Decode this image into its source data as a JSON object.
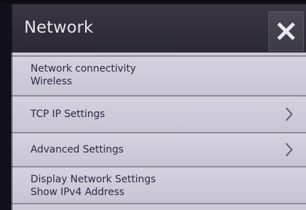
{
  "header": {
    "title": "Network",
    "close_icon": "close-icon"
  },
  "items": [
    {
      "line1": "Network connectivity",
      "line2": "Wireless"
    },
    {
      "label": "TCP IP Settings",
      "icon": "chevron-right-icon"
    },
    {
      "label": "Advanced Settings",
      "icon": "chevron-right-icon"
    },
    {
      "line1": "Display Network Settings",
      "line2": "Show IPv4 Address"
    }
  ],
  "colors": {
    "titlebar": "#2b2933",
    "list_background": "#cfcad8",
    "text": "#2a2a44",
    "divider": "#8f8a99"
  }
}
